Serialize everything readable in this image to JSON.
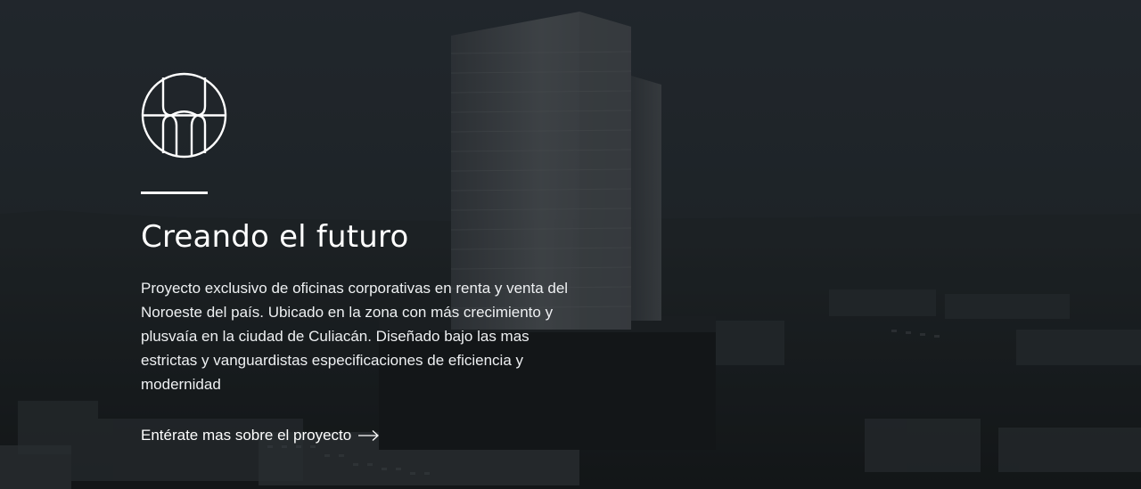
{
  "hero": {
    "logo_icon": "circle-monogram-logo",
    "title": "Creando el futuro",
    "description": "Proyecto exclusivo de oficinas corporativas en renta y venta del Noroeste del país. Ubicado en la zona con más crecimiento y plusvaía en la ciudad de Culiacán. Diseñado bajo las mas estrictas y vanguardistas especificaciones de eficiencia y modernidad",
    "cta_label": "Entérate mas sobre el proyecto",
    "cta_icon": "arrow-right-icon"
  },
  "colors": {
    "text": "#ffffff",
    "overlay": "#1c2226"
  }
}
